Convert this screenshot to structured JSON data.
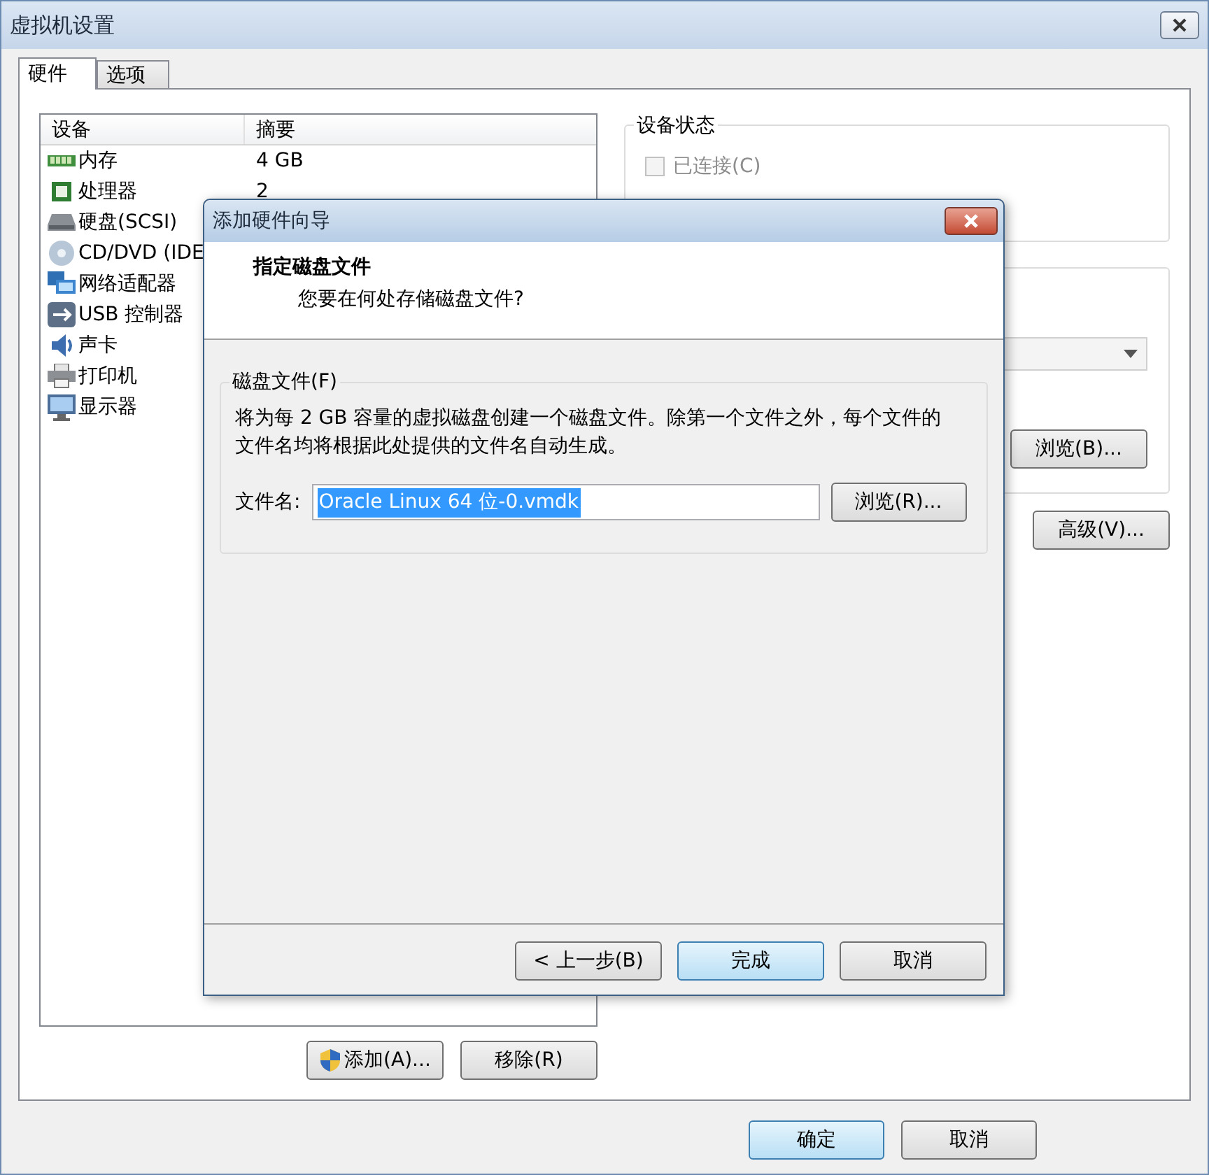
{
  "window": {
    "title": "虚拟机设置"
  },
  "tabs": [
    {
      "label": "硬件",
      "selected": true
    },
    {
      "label": "选项",
      "selected": false
    }
  ],
  "device_list": {
    "columns": [
      "设备",
      "摘要"
    ],
    "rows": [
      {
        "device": "内存",
        "summary": "4 GB"
      },
      {
        "device": "处理器",
        "summary": "2"
      },
      {
        "device": "硬盘(SCSI)"
      },
      {
        "device": "CD/DVD (IDE"
      },
      {
        "device": "网络适配器"
      },
      {
        "device": "USB 控制器"
      },
      {
        "device": "声卡"
      },
      {
        "device": "打印机"
      },
      {
        "device": "显示器"
      }
    ]
  },
  "device_status": {
    "title": "设备状态",
    "options": [
      {
        "label": "已连接(C)",
        "checked": false,
        "disabled": true
      }
    ]
  },
  "connection": {
    "browse_button": "浏览(B)..."
  },
  "advanced_button": "高级(V)...",
  "list_buttons": [
    "添加(A)...",
    "移除(R)"
  ],
  "footer_buttons": [
    {
      "label": "确定",
      "default": true
    },
    {
      "label": "取消",
      "default": false
    }
  ],
  "wizard": {
    "title": "添加硬件向导",
    "heading": "指定磁盘文件",
    "subheading": "您要在何处存储磁盘文件?",
    "group_title": "磁盘文件(F)",
    "description": "将为每 2 GB 容量的虚拟磁盘创建一个磁盘文件。除第一个文件之外，每个文件的文件名均将根据此处提供的文件名自动生成。",
    "file_label": "文件名:",
    "file_value": "Oracle Linux 64 位-0.vmdk",
    "file_value_selected": true,
    "browse_button": "浏览(R)...",
    "buttons": [
      {
        "label": "< 上一步(B)",
        "default": false
      },
      {
        "label": "完成",
        "default": true
      },
      {
        "label": "取消",
        "default": false
      }
    ]
  }
}
